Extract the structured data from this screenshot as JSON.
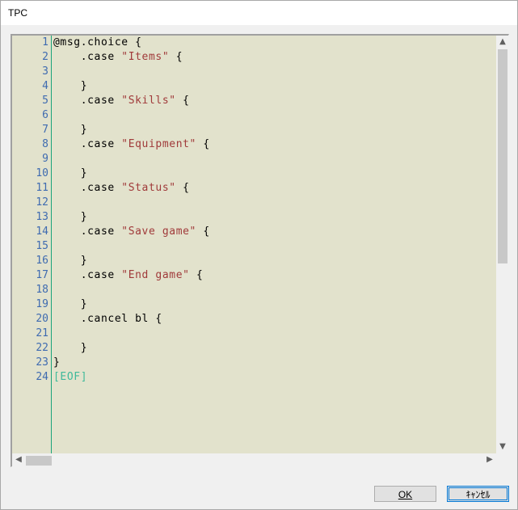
{
  "window": {
    "title": "TPC"
  },
  "editor": {
    "line_numbers": [
      "1",
      "2",
      "3",
      "4",
      "5",
      "6",
      "7",
      "8",
      "9",
      "10",
      "11",
      "12",
      "13",
      "14",
      "15",
      "16",
      "17",
      "18",
      "19",
      "20",
      "21",
      "22",
      "23",
      "24"
    ],
    "lines": [
      [
        "@msg.choice {"
      ],
      [
        "    .case ",
        {
          "s": "\"Items\""
        },
        " {"
      ],
      [
        ""
      ],
      [
        "    }"
      ],
      [
        "    .case ",
        {
          "s": "\"Skills\""
        },
        " {"
      ],
      [
        ""
      ],
      [
        "    }"
      ],
      [
        "    .case ",
        {
          "s": "\"Equipment\""
        },
        " {"
      ],
      [
        ""
      ],
      [
        "    }"
      ],
      [
        "    .case ",
        {
          "s": "\"Status\""
        },
        " {"
      ],
      [
        ""
      ],
      [
        "    }"
      ],
      [
        "    .case ",
        {
          "s": "\"Save game\""
        },
        " {"
      ],
      [
        ""
      ],
      [
        "    }"
      ],
      [
        "    .case ",
        {
          "s": "\"End game\""
        },
        " {"
      ],
      [
        ""
      ],
      [
        "    }"
      ],
      [
        "    .cancel bl {"
      ],
      [
        ""
      ],
      [
        "    }"
      ],
      [
        "}"
      ],
      [
        {
          "e": "[EOF]"
        }
      ]
    ]
  },
  "buttons": {
    "ok_label": "OK",
    "cancel_label": "ｷｬﾝｾﾙ"
  },
  "icons": {
    "scroll_up": "chevron-up-icon",
    "scroll_down": "chevron-down-icon",
    "scroll_left": "chevron-left-icon",
    "scroll_right": "chevron-right-icon"
  }
}
